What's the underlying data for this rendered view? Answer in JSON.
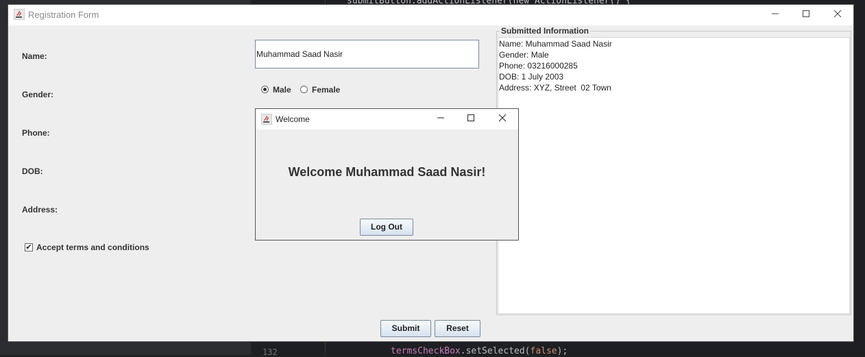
{
  "background_ide": {
    "code_top": "submitButton.addActionListener(new ActionListener() {",
    "line_number": "132",
    "code_bottom_object": "termsCheckBox",
    "code_bottom_method": ".setSelected(",
    "code_bottom_value": "false",
    "code_bottom_end": ");"
  },
  "window": {
    "title": "Registration Form",
    "controls": {
      "minimize": "—",
      "maximize": "☐",
      "close": "✕"
    }
  },
  "form": {
    "name_label": "Name:",
    "name_value": "Muhammad Saad Nasir",
    "gender_label": "Gender:",
    "gender_options": [
      "Male",
      "Female"
    ],
    "gender_selected": "Male",
    "phone_label": "Phone:",
    "dob_label": "DOB:",
    "address_label": "Address:",
    "terms_label": "Accept terms and conditions",
    "terms_checked": true,
    "submit_label": "Submit",
    "reset_label": "Reset"
  },
  "submitted_info": {
    "title": "Submitted Information",
    "lines": [
      "Name: Muhammad Saad Nasir",
      "Gender: Male",
      "Phone: 03216000285",
      "DOB: 1 July 2003",
      "Address: XYZ, Street  02 Town"
    ]
  },
  "dialog": {
    "title": "Welcome",
    "message": "Welcome Muhammad Saad Nasir!",
    "logout_label": "Log Out"
  },
  "icons": {
    "app_icon": "java-coffee-cup-icon",
    "check_glyph": "✔"
  }
}
